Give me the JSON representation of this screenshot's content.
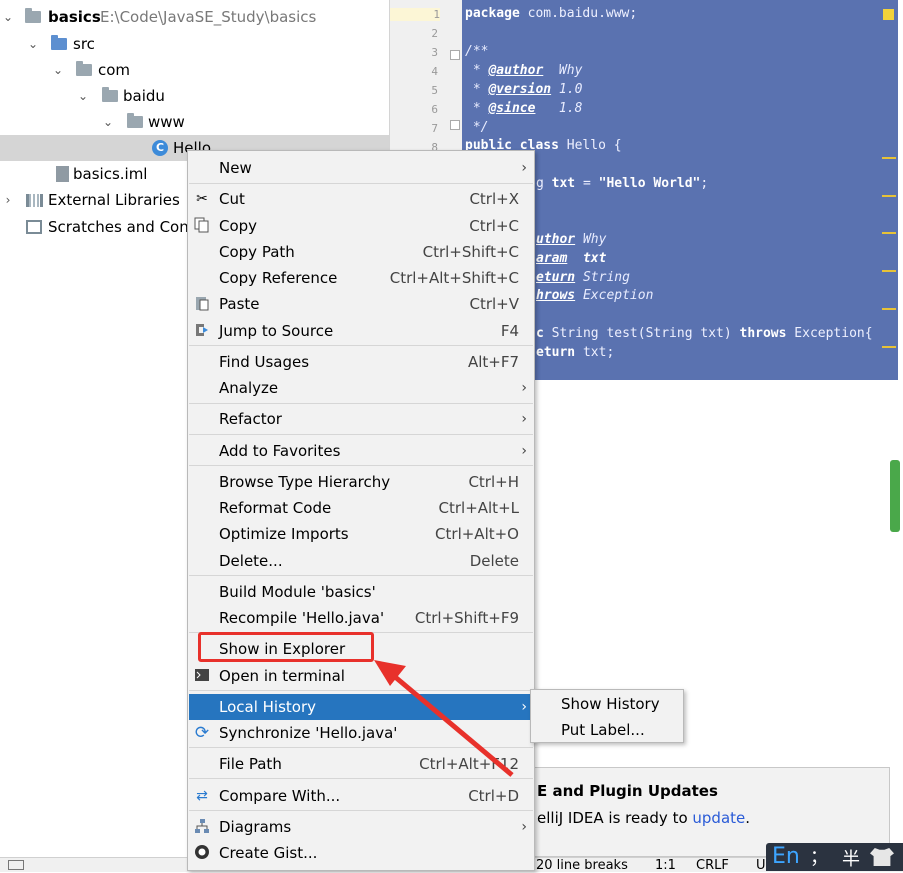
{
  "tree": {
    "root_name": "basics",
    "root_path": "E:\\Code\\JavaSE_Study\\basics",
    "src": "src",
    "com": "com",
    "baidu": "baidu",
    "www": "www",
    "hello": "Hello",
    "hello_icon_letter": "C",
    "iml": "basics.iml",
    "ext_libs": "External Libraries",
    "scratches": "Scratches and Cons"
  },
  "editor": {
    "line_numbers": [
      "1",
      "2",
      "3",
      "4",
      "5",
      "6",
      "7",
      "8"
    ],
    "l1_kw": "package",
    "l1_rest": " com.baidu.www;",
    "l3": "/**",
    "l4_pre": " * ",
    "l4_tag": "@author",
    "l4_val": "  Why",
    "l5_pre": " * ",
    "l5_tag": "@version",
    "l5_val": " 1.0",
    "l6_pre": " * ",
    "l6_tag": "@since",
    "l6_val": "   1.8",
    "l7": " */",
    "l8_kw1": "public",
    "l8_kw2": "class",
    "l8_rest": " Hello {",
    "l10_pre": "g ",
    "l10_var": "txt",
    "l10_eq": " = ",
    "l10_str": "\"Hello World\"",
    "l10_end": ";",
    "l13_tag": "uthor",
    "l13_val": " Why",
    "l14_tag": "aram",
    "l14_val": "  txt",
    "l15_tag": "eturn",
    "l15_val": " String",
    "l16_tag": "hrows",
    "l16_val": " Exception",
    "l18_pre": "c",
    "l18_rest": " String test(String txt) ",
    "l18_kw": "throws",
    "l18_end": " Exception{",
    "l19_kw": "eturn",
    "l19_rest": " txt;"
  },
  "menu": {
    "new": "New",
    "cut": "Cut",
    "cut_sc": "Ctrl+X",
    "copy": "Copy",
    "copy_sc": "Ctrl+C",
    "copy_path": "Copy Path",
    "copy_path_sc": "Ctrl+Shift+C",
    "copy_ref": "Copy Reference",
    "copy_ref_sc": "Ctrl+Alt+Shift+C",
    "paste": "Paste",
    "paste_sc": "Ctrl+V",
    "jump": "Jump to Source",
    "jump_sc": "F4",
    "find_usages": "Find Usages",
    "find_usages_sc": "Alt+F7",
    "analyze": "Analyze",
    "refactor": "Refactor",
    "add_fav": "Add to Favorites",
    "browse_type": "Browse Type Hierarchy",
    "browse_type_sc": "Ctrl+H",
    "reformat": "Reformat Code",
    "reformat_sc": "Ctrl+Alt+L",
    "optimize": "Optimize Imports",
    "optimize_sc": "Ctrl+Alt+O",
    "delete": "Delete...",
    "delete_sc": "Delete",
    "build_module": "Build Module 'basics'",
    "recompile": "Recompile 'Hello.java'",
    "recompile_sc": "Ctrl+Shift+F9",
    "show_explorer": "Show in Explorer",
    "open_terminal": "Open in terminal",
    "local_history": "Local History",
    "synchronize": "Synchronize 'Hello.java'",
    "file_path": "File Path",
    "file_path_sc": "Ctrl+Alt+F12",
    "compare": "Compare With...",
    "compare_sc": "Ctrl+D",
    "diagrams": "Diagrams",
    "create_gist": "Create Gist..."
  },
  "submenu": {
    "show_history": "Show History",
    "put_label": "Put Label..."
  },
  "notification": {
    "title": "E and Plugin Updates",
    "body": "elliJ IDEA is ready to ",
    "link": "update",
    "end": "."
  },
  "status": {
    "line_breaks": "20 line breaks",
    "position": "1:1",
    "crlf": "CRLF",
    "enc": "U"
  },
  "ime": {
    "lang": "En",
    "punct": "；",
    "width": "半"
  },
  "colors": {
    "selection": "#5a72b0",
    "highlight": "#2675bf",
    "annotation": "#e8312b"
  }
}
